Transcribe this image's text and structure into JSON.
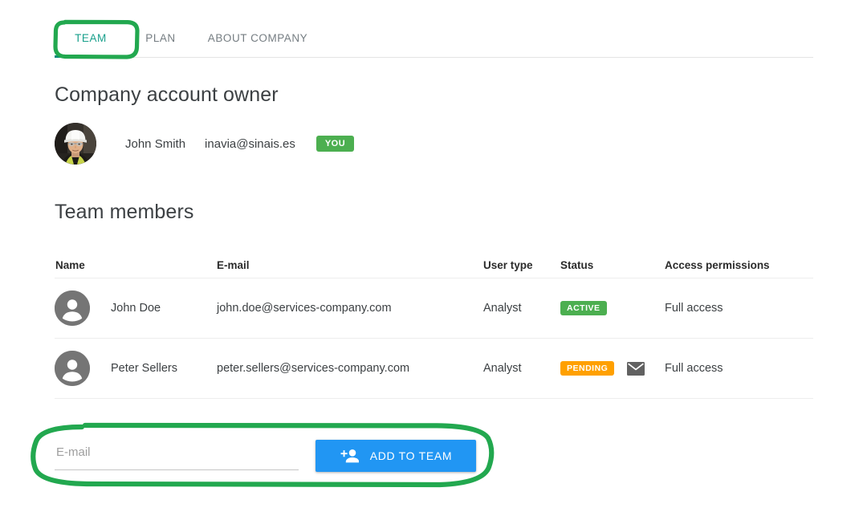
{
  "tabs": [
    {
      "label": "TEAM",
      "active": true
    },
    {
      "label": "PLAN",
      "active": false
    },
    {
      "label": "ABOUT COMPANY",
      "active": false
    }
  ],
  "sections": {
    "owner_heading": "Company account owner",
    "members_heading": "Team members"
  },
  "owner": {
    "name": "John Smith",
    "email": "inavia@sinais.es",
    "badge": "YOU",
    "avatar": "owner-photo-avatar"
  },
  "table": {
    "headers": {
      "name": "Name",
      "email": "E-mail",
      "user_type": "User type",
      "status": "Status",
      "access": "Access permissions"
    },
    "rows": [
      {
        "name": "John Doe",
        "email": "john.doe@services-company.com",
        "user_type": "Analyst",
        "status": "ACTIVE",
        "status_color": "#4caf50",
        "has_resend_mail_icon": false,
        "access": "Full access"
      },
      {
        "name": "Peter Sellers",
        "email": "peter.sellers@services-company.com",
        "user_type": "Analyst",
        "status": "PENDING",
        "status_color": "#ffa000",
        "has_resend_mail_icon": true,
        "access": "Full access"
      }
    ]
  },
  "add_form": {
    "email_placeholder": "E-mail",
    "email_value": "",
    "button_label": "ADD TO TEAM",
    "button_icon": "person-add-icon"
  },
  "annotations": {
    "color": "#22a84f",
    "tab_highlight": "TEAM",
    "form_highlight": "add-to-team-form"
  },
  "colors": {
    "accent_tab": "#00897b",
    "button_blue": "#2196f3",
    "badge_green": "#4caf50",
    "badge_orange": "#ffa000",
    "annotation_green": "#22a84f"
  }
}
